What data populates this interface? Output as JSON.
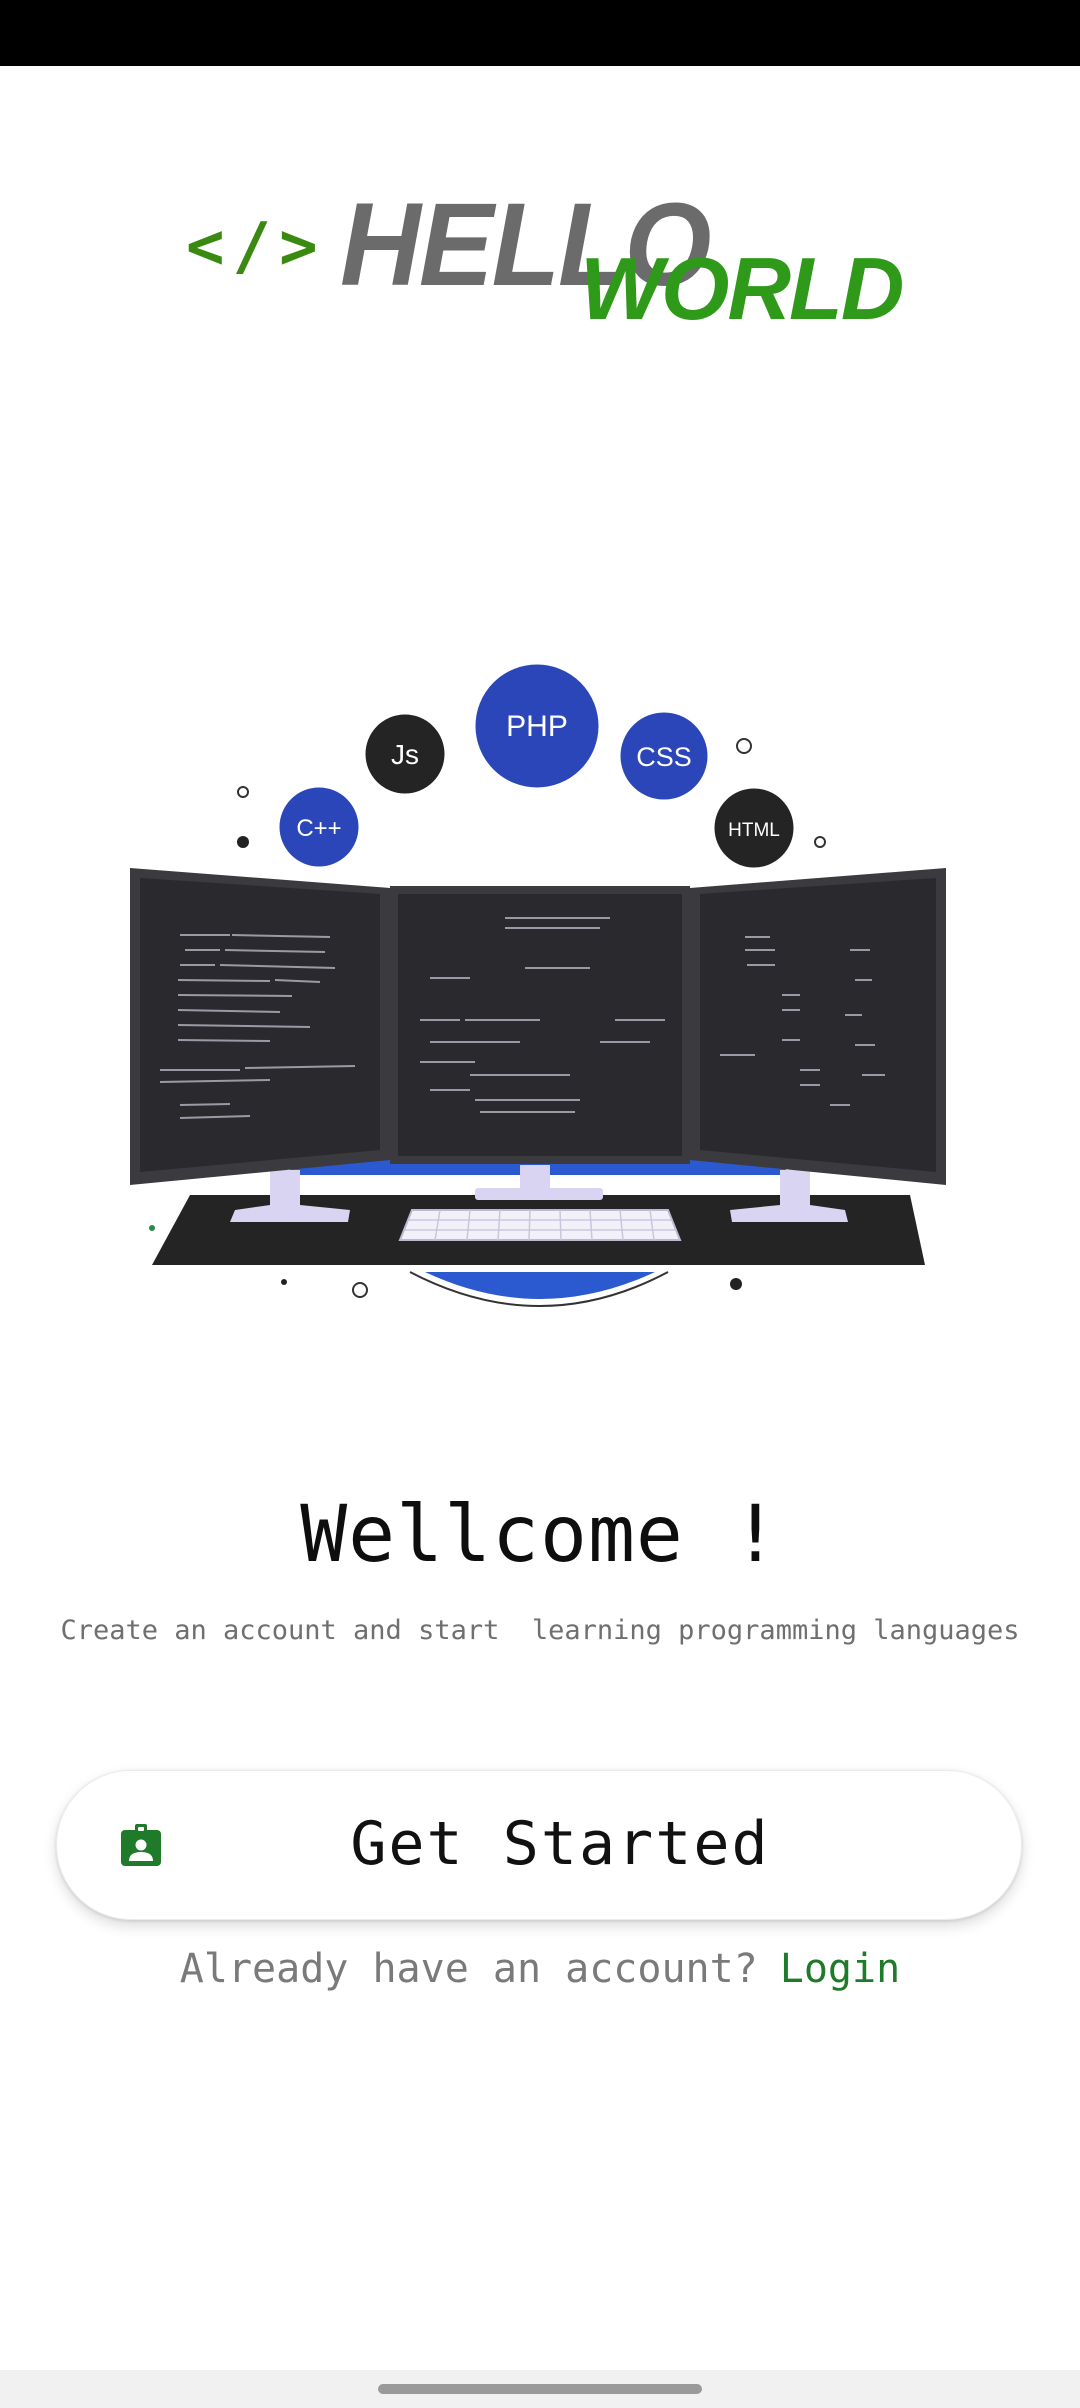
{
  "logo": {
    "code_symbol": "</>",
    "hello": "HELLO",
    "world": "WORLD"
  },
  "hero": {
    "language_badges": [
      "C++",
      "Js",
      "PHP",
      "CSS",
      "HTML"
    ]
  },
  "welcome": {
    "title": "Wellcome !",
    "subtitle": "Create an account and start  learning programming languages"
  },
  "get_started": {
    "icon": "badge-icon",
    "label": "Get Started"
  },
  "login_prompt": {
    "text": "Already have an account?",
    "link": "Login"
  },
  "colors": {
    "brand_green": "#2f9a1a",
    "link_green": "#1f7a2a",
    "hero_blue": "#2b59d0"
  }
}
